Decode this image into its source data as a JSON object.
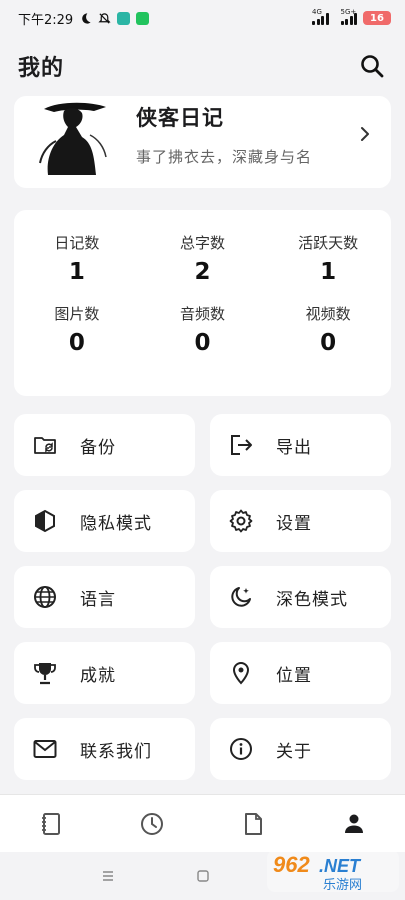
{
  "status": {
    "time": "下午2:29",
    "net1": "4G",
    "net2": "5G+",
    "battery": "16"
  },
  "header": {
    "title": "我的"
  },
  "profile": {
    "name": "侠客日记",
    "motto": "事了拂衣去，深藏身与名"
  },
  "stats": [
    {
      "label": "日记数",
      "value": "1"
    },
    {
      "label": "总字数",
      "value": "2"
    },
    {
      "label": "活跃天数",
      "value": "1"
    },
    {
      "label": "图片数",
      "value": "0"
    },
    {
      "label": "音频数",
      "value": "0"
    },
    {
      "label": "视频数",
      "value": "0"
    }
  ],
  "menu": [
    {
      "label": "备份",
      "icon": "folder-sync-icon"
    },
    {
      "label": "导出",
      "icon": "export-icon"
    },
    {
      "label": "隐私模式",
      "icon": "privacy-icon"
    },
    {
      "label": "设置",
      "icon": "gear-icon"
    },
    {
      "label": "语言",
      "icon": "globe-icon"
    },
    {
      "label": "深色模式",
      "icon": "dark-mode-icon"
    },
    {
      "label": "成就",
      "icon": "trophy-icon"
    },
    {
      "label": "位置",
      "icon": "location-icon"
    },
    {
      "label": "联系我们",
      "icon": "mail-icon"
    },
    {
      "label": "关于",
      "icon": "info-icon"
    }
  ],
  "nav": {
    "items": [
      "diary-icon",
      "history-icon",
      "document-icon",
      "profile-icon"
    ],
    "active_color": "#1c1c1e",
    "inactive_color": "#555555"
  },
  "watermark": {
    "main": "962.NET",
    "sub": "乐游网"
  }
}
